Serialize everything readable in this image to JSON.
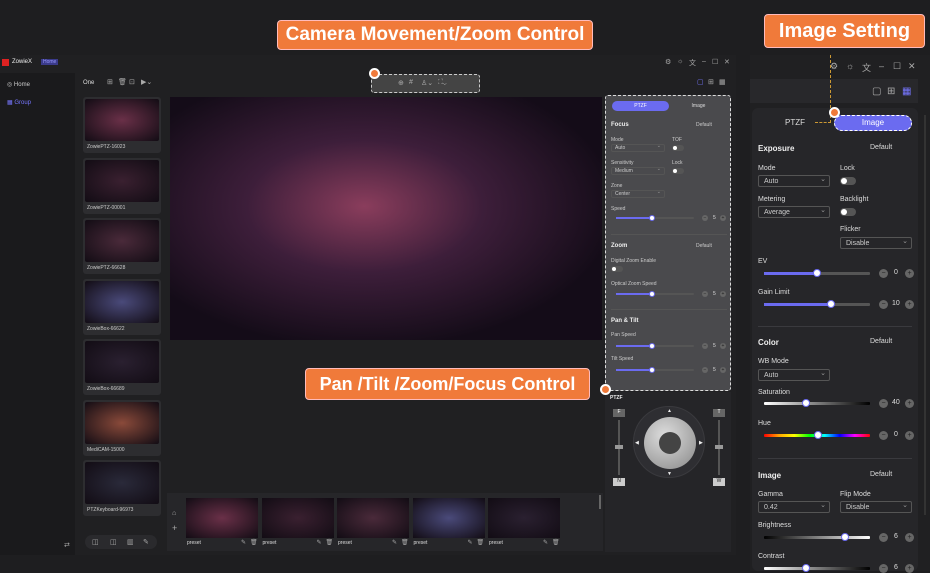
{
  "callouts": {
    "camera": "Camera Movement/Zoom Control",
    "image": "Image Setting",
    "ptzf": "Pan /Tilt /Zoom/Focus Control"
  },
  "app": {
    "name": "ZowieX",
    "badge": "Home"
  },
  "sidebar": {
    "items": [
      {
        "label": "Home",
        "icon": "home-icon"
      },
      {
        "label": "Group",
        "icon": "group-icon",
        "active": true
      }
    ]
  },
  "toolbar": {
    "view": "One"
  },
  "cameras": [
    "ZowiePTZ-16023",
    "ZowiePTZ-00001",
    "ZowiePTZ-66628",
    "ZowieBox-66622",
    "ZowieBox-66689",
    "MediCAM-15000",
    "PTZKeyboard-96973"
  ],
  "presets": [
    "preset",
    "preset",
    "preset",
    "preset",
    "preset"
  ],
  "ptzf_panel": {
    "tabs": [
      "PTZF",
      "Image"
    ],
    "active_tab": "PTZF",
    "focus": {
      "title": "Focus",
      "preset": "Default",
      "mode_label": "Mode",
      "mode": "Auto",
      "tof_label": "TOF",
      "sensitivity_label": "Sensitivity",
      "sensitivity": "Medium",
      "lock_label": "Lock",
      "zone_label": "Zone",
      "zone": "Center",
      "speed_label": "Speed",
      "speed": "5"
    },
    "zoom": {
      "title": "Zoom",
      "preset": "Default",
      "digital_label": "Digital Zoom Enable",
      "optical_label": "Optical Zoom Speed",
      "optical": "5"
    },
    "pantilt": {
      "title": "Pan & Tilt",
      "pan_label": "Pan Speed",
      "pan": "5",
      "tilt_label": "Tilt Speed",
      "tilt": "5"
    },
    "joystick": {
      "title": "PTZF",
      "f": "F",
      "n": "N",
      "t": "T",
      "w": "W"
    }
  },
  "image_panel": {
    "tabs": [
      "PTZF",
      "Image"
    ],
    "active_tab": "Image",
    "exposure": {
      "title": "Exposure",
      "preset": "Default",
      "mode_label": "Mode",
      "mode": "Auto",
      "lock_label": "Lock",
      "metering_label": "Metering",
      "metering": "Average",
      "backlight_label": "Backlight",
      "flicker_label": "Flicker",
      "flicker": "Disable",
      "ev_label": "EV",
      "ev": "0",
      "gain_label": "Gain Limit",
      "gain": "10"
    },
    "color": {
      "title": "Color",
      "preset": "Default",
      "wb_label": "WB Mode",
      "wb": "Auto",
      "sat_label": "Saturation",
      "sat": "40",
      "hue_label": "Hue",
      "hue": "0"
    },
    "image": {
      "title": "Image",
      "preset": "Default",
      "gamma_label": "Gamma",
      "gamma": "0.42",
      "flip_label": "Flip Mode",
      "flip": "Disable",
      "bright_label": "Brightness",
      "bright": "6",
      "contrast_label": "Contrast",
      "contrast": "6"
    }
  },
  "colors": {
    "accent": "#6b6bf0",
    "callout": "#f07a3a"
  }
}
